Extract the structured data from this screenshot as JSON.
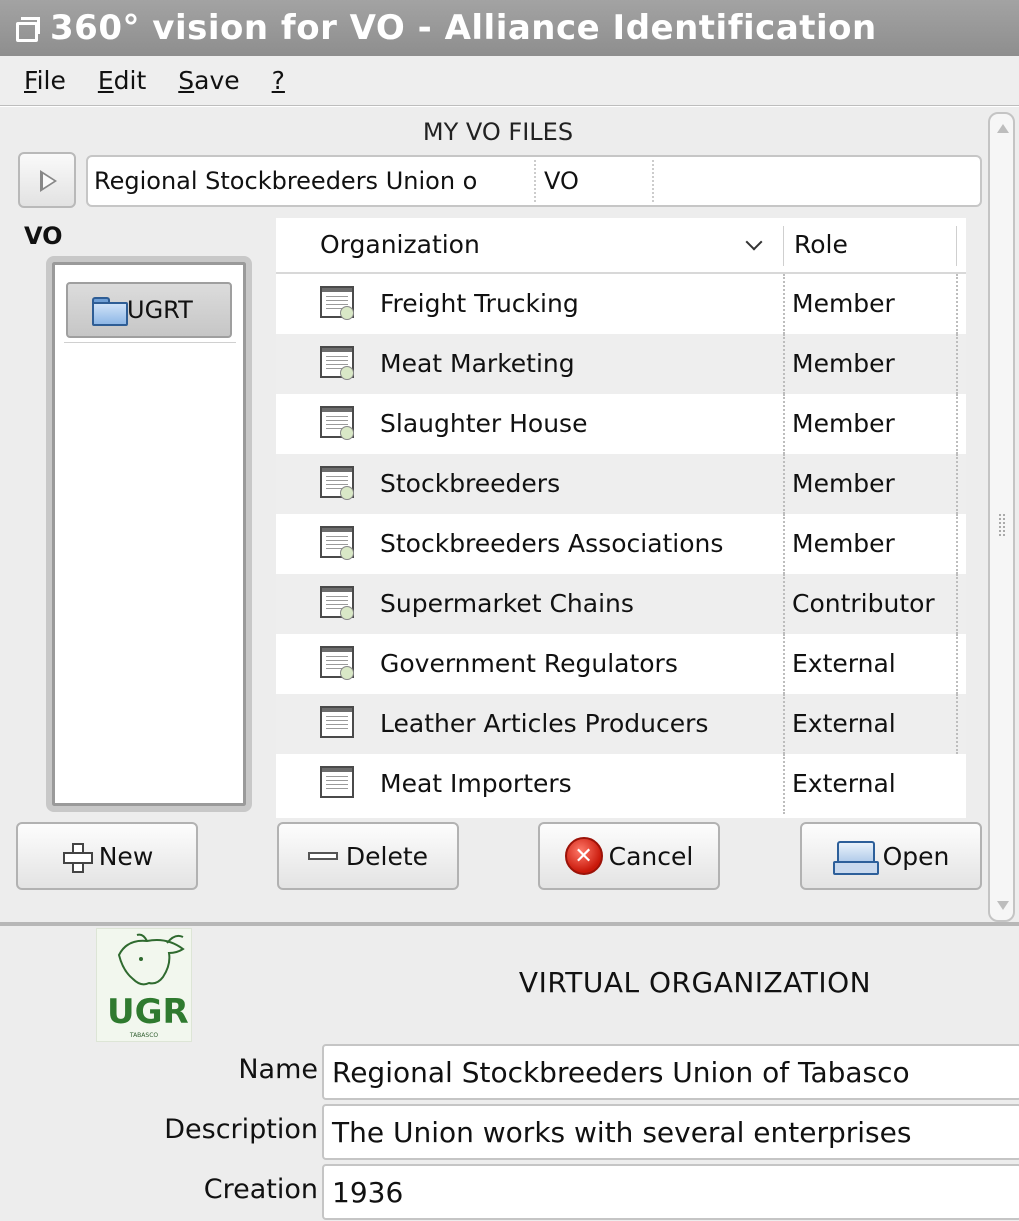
{
  "window": {
    "title": "360° vision for VO - Alliance Identification"
  },
  "menu": [
    {
      "mnemonic": "F",
      "rest": "ile"
    },
    {
      "mnemonic": "E",
      "rest": "dit"
    },
    {
      "mnemonic": "S",
      "rest": "ave"
    },
    {
      "mnemonic": "?",
      "rest": ""
    }
  ],
  "my_vo_files": {
    "title": "MY VO FILES",
    "selector": {
      "name": "Regional Stockbreeders Union o",
      "type": "VO"
    }
  },
  "vo_panel": {
    "label": "VO",
    "items": [
      "UGRT"
    ]
  },
  "table": {
    "headers": {
      "organization": "Organization",
      "role": "Role"
    },
    "rows": [
      {
        "organization": "Freight Trucking",
        "role": "Member"
      },
      {
        "organization": "Meat Marketing",
        "role": "Member"
      },
      {
        "organization": "Slaughter House",
        "role": "Member"
      },
      {
        "organization": "Stockbreeders",
        "role": "Member"
      },
      {
        "organization": "Stockbreeders Associations",
        "role": "Member"
      },
      {
        "organization": "Supermarket Chains",
        "role": "Contributor"
      },
      {
        "organization": "Government Regulators",
        "role": "External"
      },
      {
        "organization": "Leather Articles Producers",
        "role": "External"
      },
      {
        "organization": "Meat Importers",
        "role": "External"
      }
    ]
  },
  "buttons": {
    "new": "New",
    "delete": "Delete",
    "cancel": "Cancel",
    "open": "Open"
  },
  "virtual_organization": {
    "title": "VIRTUAL ORGANIZATION",
    "logo_text": "UGR",
    "logo_sub": "TABASCO",
    "fields": {
      "name_label": "Name",
      "name_value": "Regional Stockbreeders Union of Tabasco",
      "description_label": "Description",
      "description_value": "The Union works with several enterprises",
      "creation_label": "Creation",
      "creation_value": "1936"
    }
  },
  "colors": {
    "titlebar": "#999999",
    "cancel_icon": "#d0200f",
    "folder_icon": "#6f9fd6"
  }
}
